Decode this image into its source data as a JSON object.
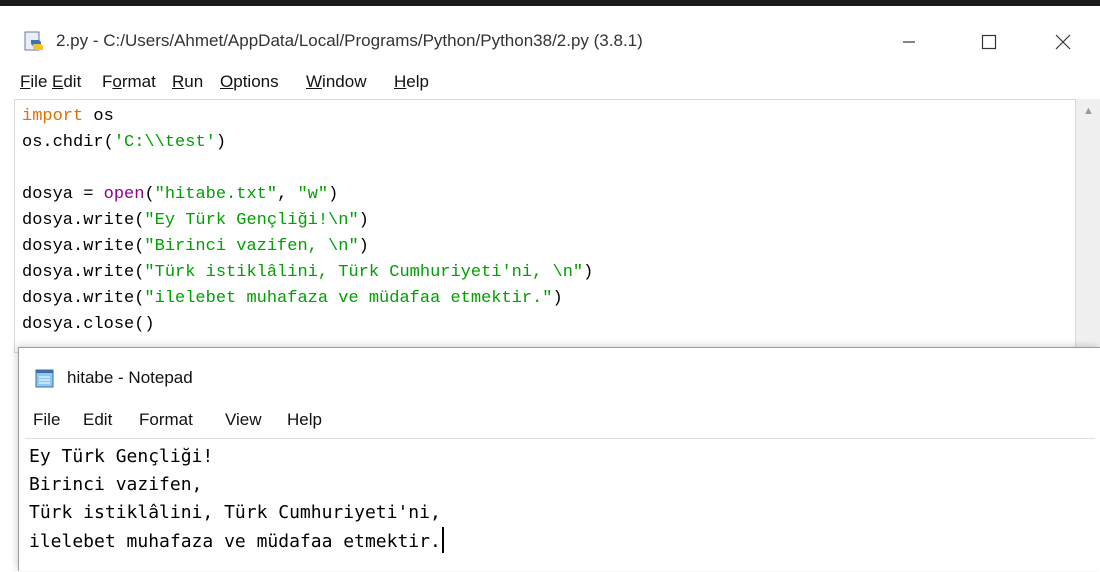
{
  "idle": {
    "title": "2.py - C:/Users/Ahmet/AppData/Local/Programs/Python/Python38/2.py (3.8.1)",
    "window_buttons": {
      "minimize": "—",
      "maximize": "☐",
      "close": "✕"
    },
    "menu": [
      {
        "u": "F",
        "rest": "ile"
      },
      {
        "u": "E",
        "rest": "dit"
      },
      {
        "pre": "F",
        "u": "o",
        "rest": "rmat"
      },
      {
        "u": "R",
        "rest": "un"
      },
      {
        "u": "O",
        "rest": "ptions"
      },
      {
        "u": "W",
        "rest": "indow"
      },
      {
        "u": "H",
        "rest": "elp"
      }
    ],
    "code_lines": [
      [
        {
          "t": "import",
          "c": "kw"
        },
        {
          "t": " os"
        }
      ],
      [
        {
          "t": "os.chdir("
        },
        {
          "t": "'C:\\\\test'",
          "c": "st"
        },
        {
          "t": ")"
        }
      ],
      [],
      [
        {
          "t": "dosya = "
        },
        {
          "t": "open",
          "c": "bi"
        },
        {
          "t": "("
        },
        {
          "t": "\"hitabe.txt\"",
          "c": "st"
        },
        {
          "t": ", "
        },
        {
          "t": "\"w\"",
          "c": "st"
        },
        {
          "t": ")"
        }
      ],
      [
        {
          "t": "dosya.write("
        },
        {
          "t": "\"Ey Türk Gençliği!\\n\"",
          "c": "st"
        },
        {
          "t": ")"
        }
      ],
      [
        {
          "t": "dosya.write("
        },
        {
          "t": "\"Birinci vazifen, \\n\"",
          "c": "st"
        },
        {
          "t": ")"
        }
      ],
      [
        {
          "t": "dosya.write("
        },
        {
          "t": "\"Türk istiklâlini, Türk Cumhuriyeti'ni, \\n\"",
          "c": "st"
        },
        {
          "t": ")"
        }
      ],
      [
        {
          "t": "dosya.write("
        },
        {
          "t": "\"ilelebet muhafaza ve müdafaa etmektir.\"",
          "c": "st"
        },
        {
          "t": ")"
        }
      ],
      [
        {
          "t": "dosya.close()"
        }
      ]
    ],
    "colors": {
      "keyword": "#e07000",
      "builtin": "#900090",
      "string": "#00a000"
    }
  },
  "notepad": {
    "title": "hitabe - Notepad",
    "menu": [
      "File",
      "Edit",
      "Format",
      "View",
      "Help"
    ],
    "lines": [
      "Ey Türk Gençliği!",
      "Birinci vazifen,",
      "Türk istiklâlini, Türk Cumhuriyeti'ni,",
      "ilelebet muhafaza ve müdafaa etmektir."
    ]
  }
}
